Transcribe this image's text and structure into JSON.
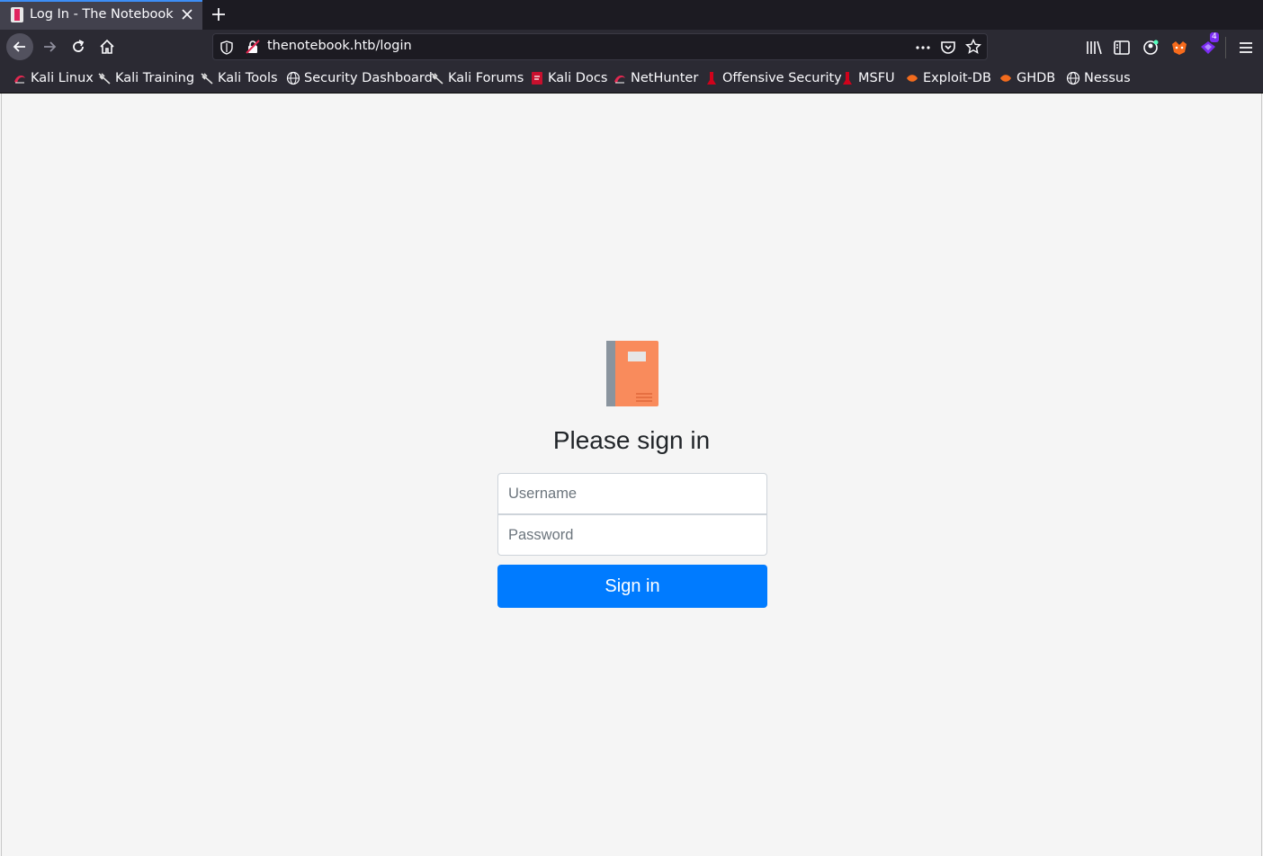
{
  "browser": {
    "tab_title": "Log In - The Notebook",
    "url": "thenotebook.htb/login",
    "extension_badge": "4",
    "bookmarks": [
      {
        "label": "Kali Linux",
        "icon": "kali-dragon-icon"
      },
      {
        "label": "Kali Training",
        "icon": "kali-dragon-icon"
      },
      {
        "label": "Kali Tools",
        "icon": "kali-dragon-icon"
      },
      {
        "label": "Security Dashboard",
        "icon": "globe-icon"
      },
      {
        "label": "Kali Forums",
        "icon": "kali-dragon-icon"
      },
      {
        "label": "Kali Docs",
        "icon": "kali-docs-icon"
      },
      {
        "label": "NetHunter",
        "icon": "kali-dragon-icon"
      },
      {
        "label": "Offensive Security",
        "icon": "offsec-icon"
      },
      {
        "label": "MSFU",
        "icon": "offsec-icon"
      },
      {
        "label": "Exploit-DB",
        "icon": "exploitdb-icon"
      },
      {
        "label": "GHDB",
        "icon": "exploitdb-icon"
      },
      {
        "label": "Nessus",
        "icon": "globe-icon"
      }
    ]
  },
  "login": {
    "heading": "Please sign in",
    "username_placeholder": "Username",
    "password_placeholder": "Password",
    "submit_label": "Sign in"
  },
  "colors": {
    "primary": "#007bff",
    "notebook_orange": "#f98b5c",
    "notebook_spine": "#8a949e"
  }
}
